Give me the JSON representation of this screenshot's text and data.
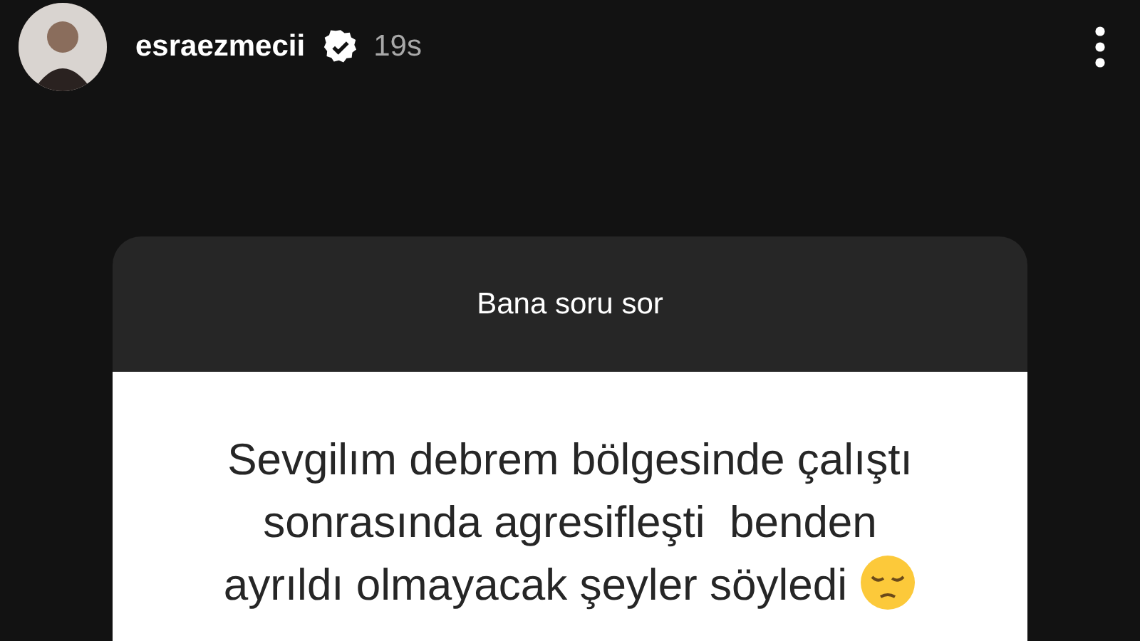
{
  "story_header": {
    "username": "esraezmecii",
    "verified": true,
    "time": "19s"
  },
  "question_card": {
    "title": "Bana soru sor",
    "answer_lines": [
      "Sevgilım debrem bölgesinde çalıştı",
      "sonrasında agresifleşti  benden",
      "ayrıldı olmayacak şeyler söyledi"
    ]
  }
}
